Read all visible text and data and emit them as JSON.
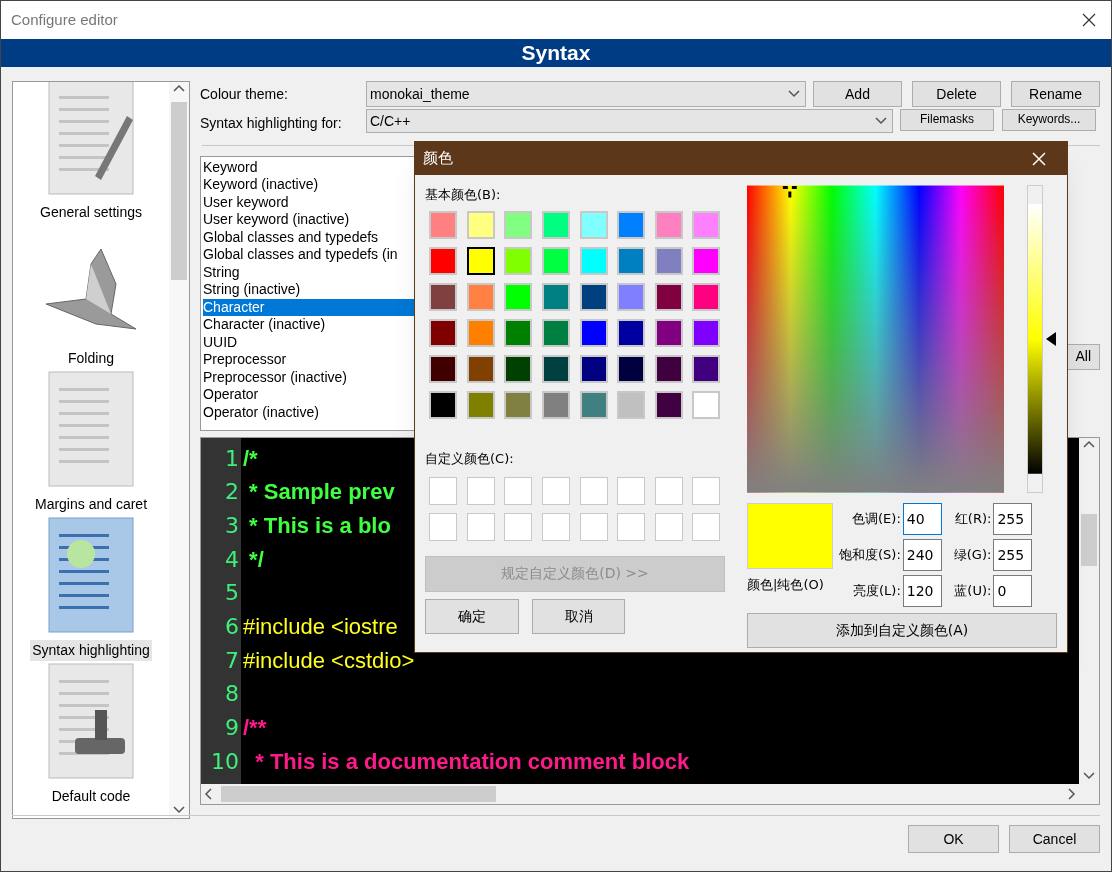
{
  "window": {
    "title": "Configure editor"
  },
  "banner": "Syntax",
  "sidebar": {
    "items": [
      {
        "label": "General settings",
        "selected": false
      },
      {
        "label": "Folding",
        "selected": false
      },
      {
        "label": "Margins and caret",
        "selected": false
      },
      {
        "label": "Syntax highlighting",
        "selected": true
      },
      {
        "label": "Default code",
        "selected": false
      }
    ]
  },
  "colour_theme": {
    "label": "Colour theme:",
    "value": "monokai_theme"
  },
  "theme_buttons": [
    "Add",
    "Delete",
    "Rename"
  ],
  "highlighting_for": {
    "label": "Syntax highlighting for:",
    "value": "C/C++"
  },
  "lang_buttons": [
    "Filemasks",
    "Keywords..."
  ],
  "styles": [
    {
      "label": "Keyword",
      "selected": false
    },
    {
      "label": "Keyword (inactive)",
      "selected": false
    },
    {
      "label": "User keyword",
      "selected": false
    },
    {
      "label": "User keyword (inactive)",
      "selected": false
    },
    {
      "label": "Global classes and typedefs",
      "selected": false
    },
    {
      "label": "Global classes and typedefs (in",
      "selected": false
    },
    {
      "label": "String",
      "selected": false
    },
    {
      "label": "String (inactive)",
      "selected": false
    },
    {
      "label": "Character",
      "selected": true
    },
    {
      "label": "Character (inactive)",
      "selected": false
    },
    {
      "label": "UUID",
      "selected": false
    },
    {
      "label": "Preprocessor",
      "selected": false
    },
    {
      "label": "Preprocessor (inactive)",
      "selected": false
    },
    {
      "label": "Operator",
      "selected": false
    },
    {
      "label": "Operator (inactive)",
      "selected": false
    }
  ],
  "all_button": "All",
  "code_lines": [
    {
      "number": "1",
      "text": "/*",
      "kind": "comment"
    },
    {
      "number": "2",
      "text": " * Sample prev",
      "kind": "comment"
    },
    {
      "number": "3",
      "text": " * This is a blo",
      "kind": "comment"
    },
    {
      "number": "4",
      "text": " */",
      "kind": "comment"
    },
    {
      "number": "5",
      "kind": "blank"
    },
    {
      "number": "6",
      "text": "#include <iostre",
      "kind": "preprocessor"
    },
    {
      "number": "7",
      "text": "#include <cstdio>",
      "kind": "preprocessor"
    },
    {
      "number": "8",
      "kind": "blank"
    },
    {
      "number": "9",
      "text": "/**",
      "kind": "doc"
    },
    {
      "number": "10",
      "text": "  * This is a documentation comment block",
      "kind": "doc"
    }
  ],
  "dialog_buttons": [
    "OK",
    "Cancel"
  ],
  "color_dialog": {
    "title": "颜色",
    "basic_label": "基本颜色(B):",
    "basic_colors": [
      {
        "color": "#ff8080",
        "selected": false
      },
      {
        "color": "#ffff80",
        "selected": false
      },
      {
        "color": "#80ff80",
        "selected": false
      },
      {
        "color": "#00ff80",
        "selected": false
      },
      {
        "color": "#80ffff",
        "selected": false
      },
      {
        "color": "#0080ff",
        "selected": false
      },
      {
        "color": "#ff80c0",
        "selected": false
      },
      {
        "color": "#ff80ff",
        "selected": false
      },
      {
        "color": "#ff0000",
        "selected": false
      },
      {
        "color": "#ffff00",
        "selected": true
      },
      {
        "color": "#80ff00",
        "selected": false
      },
      {
        "color": "#00ff40",
        "selected": false
      },
      {
        "color": "#00ffff",
        "selected": false
      },
      {
        "color": "#0080c0",
        "selected": false
      },
      {
        "color": "#8080c0",
        "selected": false
      },
      {
        "color": "#ff00ff",
        "selected": false
      },
      {
        "color": "#804040",
        "selected": false
      },
      {
        "color": "#ff8040",
        "selected": false
      },
      {
        "color": "#00ff00",
        "selected": false
      },
      {
        "color": "#008080",
        "selected": false
      },
      {
        "color": "#004080",
        "selected": false
      },
      {
        "color": "#8080ff",
        "selected": false
      },
      {
        "color": "#800040",
        "selected": false
      },
      {
        "color": "#ff0080",
        "selected": false
      },
      {
        "color": "#800000",
        "selected": false
      },
      {
        "color": "#ff8000",
        "selected": false
      },
      {
        "color": "#008000",
        "selected": false
      },
      {
        "color": "#008040",
        "selected": false
      },
      {
        "color": "#0000ff",
        "selected": false
      },
      {
        "color": "#0000a0",
        "selected": false
      },
      {
        "color": "#800080",
        "selected": false
      },
      {
        "color": "#8000ff",
        "selected": false
      },
      {
        "color": "#400000",
        "selected": false
      },
      {
        "color": "#804000",
        "selected": false
      },
      {
        "color": "#004000",
        "selected": false
      },
      {
        "color": "#004040",
        "selected": false
      },
      {
        "color": "#000080",
        "selected": false
      },
      {
        "color": "#000040",
        "selected": false
      },
      {
        "color": "#400040",
        "selected": false
      },
      {
        "color": "#400080",
        "selected": false
      },
      {
        "color": "#000000",
        "selected": false
      },
      {
        "color": "#808000",
        "selected": false
      },
      {
        "color": "#808040",
        "selected": false
      },
      {
        "color": "#808080",
        "selected": false
      },
      {
        "color": "#408080",
        "selected": false
      },
      {
        "color": "#c0c0c0",
        "selected": false
      },
      {
        "color": "#400041",
        "selected": false
      },
      {
        "color": "#ffffff",
        "selected": false
      }
    ],
    "custom_label": "自定义颜色(C):",
    "custom_colors": [
      {
        "color": "#ffffff"
      },
      {
        "color": "#ffffff"
      },
      {
        "color": "#ffffff"
      },
      {
        "color": "#ffffff"
      },
      {
        "color": "#ffffff"
      },
      {
        "color": "#ffffff"
      },
      {
        "color": "#ffffff"
      },
      {
        "color": "#ffffff"
      },
      {
        "color": "#ffffff"
      },
      {
        "color": "#ffffff"
      },
      {
        "color": "#ffffff"
      },
      {
        "color": "#ffffff"
      },
      {
        "color": "#ffffff"
      },
      {
        "color": "#ffffff"
      },
      {
        "color": "#ffffff"
      },
      {
        "color": "#ffffff"
      }
    ],
    "define_button": {
      "label": "规定自定义颜色(D) >>",
      "disabled": true
    },
    "ok_button": "确定",
    "cancel_button": "取消",
    "preview": {
      "color": "#ffff00"
    },
    "preview_label": "颜色|纯色(O)",
    "luminance": {
      "level": 0.5
    },
    "fields": [
      {
        "label": "色调(E):",
        "value": "40",
        "focused": true
      },
      {
        "label": "饱和度(S):",
        "value": "240",
        "focused": false
      },
      {
        "label": "亮度(L):",
        "value": "120",
        "focused": false
      },
      {
        "label": "红(R):",
        "value": "255",
        "focused": false
      },
      {
        "label": "绿(G):",
        "value": "255",
        "focused": false
      },
      {
        "label": "蓝(U):",
        "value": "0",
        "focused": false
      }
    ],
    "add_button": "添加到自定义颜色(A)"
  }
}
